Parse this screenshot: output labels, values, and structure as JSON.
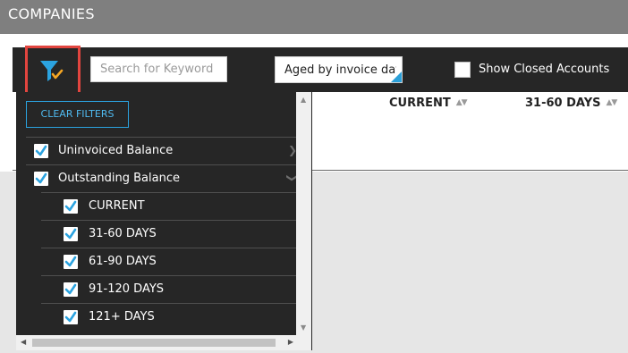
{
  "window": {
    "title": "COMPANIES"
  },
  "toolbar": {
    "filter_icon": "funnel-check-icon",
    "search_placeholder": "Search for Keyword",
    "aged_value": "Aged by invoice date",
    "show_closed_label": "Show Closed Accounts",
    "show_closed_checked": false
  },
  "columns": [
    {
      "label": "CURRENT"
    },
    {
      "label": "31-60 DAYS"
    }
  ],
  "filters": {
    "clear_label": "CLEAR FILTERS",
    "groups": [
      {
        "label": "Uninvoiced Balance",
        "checked": true,
        "expanded": false
      },
      {
        "label": "Outstanding Balance",
        "checked": true,
        "expanded": true
      }
    ],
    "items": [
      {
        "label": "CURRENT",
        "checked": true
      },
      {
        "label": "31-60 DAYS",
        "checked": true
      },
      {
        "label": "61-90 DAYS",
        "checked": true
      },
      {
        "label": "91-120 DAYS",
        "checked": true
      },
      {
        "label": "121+ DAYS",
        "checked": true
      }
    ]
  },
  "colors": {
    "accent": "#2ba3e0",
    "highlight_border": "#e2453f",
    "toolbar_bg": "#262626",
    "titlebar_bg": "#7f7f7f",
    "filter_check": "#f5a623"
  }
}
